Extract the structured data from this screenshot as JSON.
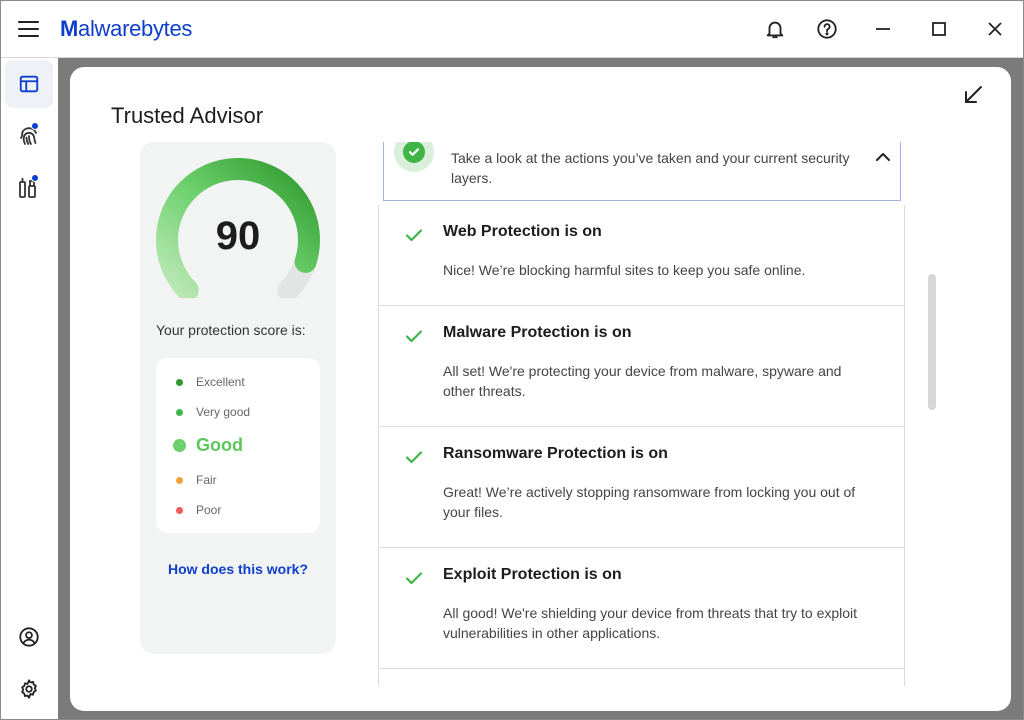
{
  "app": {
    "logo_bold": "M",
    "logo_rest": "alwarebytes",
    "brand_color": "#0d3ecc"
  },
  "titlebar": {
    "icons": [
      "notifications-icon",
      "help-icon",
      "minimize-icon",
      "maximize-icon",
      "close-icon"
    ]
  },
  "sidebar": {
    "icons": [
      "dashboard-icon",
      "fingerprint-icon",
      "tools-icon",
      "account-icon",
      "settings-icon"
    ]
  },
  "page": {
    "title": "Trusted Advisor"
  },
  "score": {
    "value": "90",
    "label": "Your protection score is:",
    "gauge_fraction": 0.9,
    "gauge_color": "#3fb548",
    "legend": [
      {
        "label": "Excellent",
        "color": "#2e9a2e",
        "current": false
      },
      {
        "label": "Very good",
        "color": "#3fb548",
        "current": false
      },
      {
        "label": "Good",
        "color": "#6cd06c",
        "current": true
      },
      {
        "label": "Fair",
        "color": "#f2a23a",
        "current": false
      },
      {
        "label": "Poor",
        "color": "#f05a5a",
        "current": false
      }
    ],
    "help_link": "How does this work?"
  },
  "summary": {
    "text": "Take a look at the actions you’ve taken and your current security layers."
  },
  "items": [
    {
      "title": "Web Protection is on",
      "desc": "Nice! We’re blocking harmful sites to keep you safe online."
    },
    {
      "title": "Malware Protection is on",
      "desc": "All set! We're protecting your device from malware, spyware and other threats."
    },
    {
      "title": "Ransomware Protection is on",
      "desc": "Great! We’re actively stopping ransomware from locking you out of your files."
    },
    {
      "title": "Exploit Protection is on",
      "desc": "All good! We're shielding your device from threats that try to exploit vulnerabilities in other applications."
    }
  ]
}
